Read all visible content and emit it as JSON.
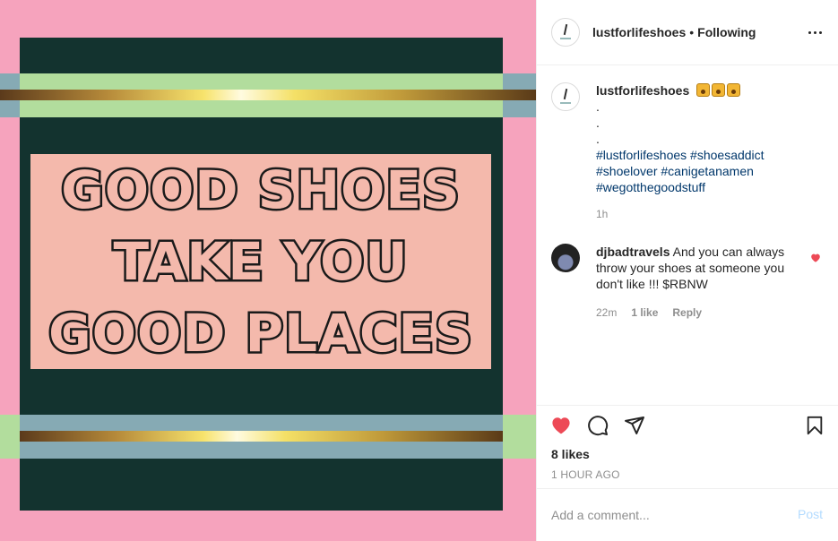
{
  "image": {
    "slogan_lines": [
      "GOOD SHOES",
      "TAKE YOU",
      "GOOD PLACES"
    ],
    "colors": {
      "background": "#f6a3bd",
      "panel": "#13332f",
      "slogan_box": "#f4b9ac",
      "green_stripe": "#b2dd9d",
      "blue_stripe": "#86aab4"
    }
  },
  "header": {
    "username": "lustforlifeshoes",
    "separator": "•",
    "follow_status": "Following",
    "more_icon": "more-horizontal-icon"
  },
  "caption": {
    "username": "lustforlifeshoes",
    "emoji_names": [
      "raising-hands-emoji",
      "raising-hands-emoji",
      "raising-hands-emoji"
    ],
    "dot_lines": [
      ".",
      ".",
      "."
    ],
    "hashtags_line1": "#lustforlifeshoes #shoesaddict",
    "hashtags_line2": "#shoelover #canigetanamen",
    "hashtags_line3": "#wegotthegoodstuff",
    "time": "1h"
  },
  "reply": {
    "username": "djbadtravels",
    "text": "And you can always throw your shoes at someone you don't like !!! $RBNW",
    "time": "22m",
    "likes": "1 like",
    "reply_label": "Reply",
    "liked": true
  },
  "actions": {
    "likes": "8 likes",
    "posted": "1 HOUR AGO",
    "liked": true,
    "accent": "#ed4956"
  },
  "add_comment": {
    "placeholder": "Add a comment...",
    "post_label": "Post"
  }
}
